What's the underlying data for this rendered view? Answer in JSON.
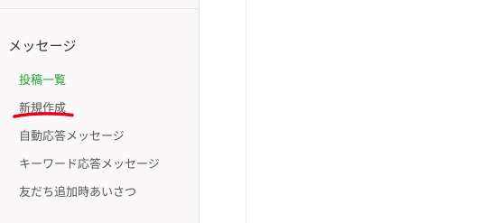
{
  "sidebar": {
    "section_title": "メッセージ",
    "items": [
      {
        "label": "投稿一覧",
        "active": true
      },
      {
        "label": "新規作成",
        "active": false
      },
      {
        "label": "自動応答メッセージ",
        "active": false
      },
      {
        "label": "キーワード応答メッセージ",
        "active": false
      },
      {
        "label": "友だち追加時あいさつ",
        "active": false
      }
    ]
  },
  "colors": {
    "active_link": "#1ca531",
    "annotation_underline": "#e8001c"
  }
}
